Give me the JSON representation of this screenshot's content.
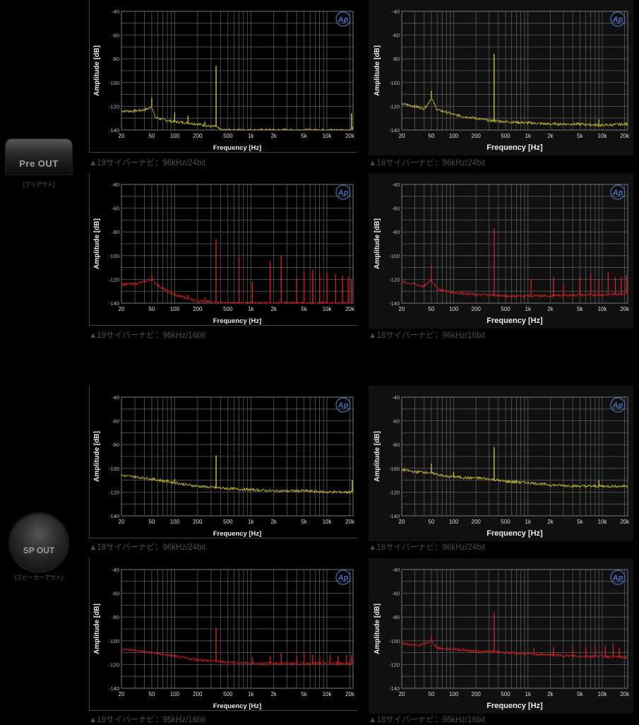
{
  "sections": [
    {
      "label": "Pre OUT",
      "sublabel": "[プリアウト]"
    },
    {
      "label": "SP OUT",
      "sublabel": "[スピーカーアウト]"
    }
  ],
  "colors": {
    "yellow": "#c8c030",
    "red": "#d02020",
    "grid": "#5a5a5a",
    "plot_bg_left": "#000000",
    "plot_bg_right": "#101010",
    "logo": "#4a6fb8"
  },
  "logo_text": "Ap",
  "chart_data": [
    {
      "type": "line",
      "caption": "▲19サイバーナビ：96kHz/24bit",
      "color": "yellow",
      "xlabel": "Frequency [Hz]",
      "ylabel": "Amplitude [dB]",
      "xticks": [
        "20",
        "50",
        "100",
        "200",
        "500",
        "1k",
        "2k",
        "5k",
        "10k",
        "20k"
      ],
      "yticks": [
        "-40",
        "-60",
        "-80",
        "-100",
        "-120",
        "-140"
      ],
      "xlim": [
        20,
        22000
      ],
      "ylim": [
        -140,
        -40
      ],
      "xscale": "log",
      "x": [
        20,
        30,
        40,
        45,
        50,
        55,
        60,
        80,
        100,
        150,
        200,
        250,
        300,
        350,
        400,
        500,
        1000,
        2000,
        5000,
        10000,
        20000,
        22000
      ],
      "y": [
        -124,
        -124,
        -123,
        -122,
        -120,
        -129,
        -130,
        -132,
        -133,
        -134,
        -135,
        -136,
        -137,
        -137,
        -140,
        -140,
        -140,
        -140,
        -140,
        -140,
        -140,
        -138
      ],
      "peaks": [
        [
          50,
          -113
        ],
        [
          100,
          -125
        ],
        [
          150,
          -128
        ],
        [
          250,
          -133
        ],
        [
          350,
          -86
        ],
        [
          21000,
          -126
        ]
      ]
    },
    {
      "type": "line",
      "caption": "▲18サイバーナビ：96kHz/24bit",
      "color": "yellow",
      "xlabel": "Frequency [Hz]",
      "ylabel": "Amplitude [dB]",
      "xticks": [
        "20",
        "50",
        "100",
        "200",
        "500",
        "1k",
        "2k",
        "5k",
        "10k",
        "20k"
      ],
      "yticks": [
        "-40",
        "-60",
        "-80",
        "-100",
        "-120",
        "-140"
      ],
      "xlim": [
        20,
        22000
      ],
      "ylim": [
        -140,
        -40
      ],
      "xscale": "log",
      "x": [
        20,
        30,
        40,
        45,
        50,
        60,
        80,
        100,
        150,
        200,
        300,
        500,
        1000,
        2000,
        5000,
        10000,
        20000,
        22000
      ],
      "y": [
        -118,
        -120,
        -122,
        -118,
        -113,
        -123,
        -125,
        -127,
        -129,
        -130,
        -132,
        -133,
        -134,
        -135,
        -135,
        -136,
        -135,
        -135
      ],
      "peaks": [
        [
          50,
          -107
        ],
        [
          120,
          -127
        ],
        [
          350,
          -76
        ],
        [
          3000,
          -134
        ],
        [
          9000,
          -131
        ]
      ]
    },
    {
      "type": "line",
      "caption": "▲19サイバーナビ：96kHz/16bit",
      "color": "red",
      "xlabel": "Frequency [Hz]",
      "ylabel": "Amplitude [dB]",
      "xticks": [
        "20",
        "50",
        "100",
        "200",
        "500",
        "1k",
        "2k",
        "5k",
        "10k",
        "20k"
      ],
      "yticks": [
        "-40",
        "-60",
        "-80",
        "-100",
        "-120",
        "-140"
      ],
      "xlim": [
        20,
        22000
      ],
      "ylim": [
        -140,
        -40
      ],
      "xscale": "log",
      "x": [
        20,
        30,
        40,
        50,
        60,
        80,
        100,
        150,
        200,
        300,
        500,
        1000,
        2000,
        5000,
        10000,
        20000,
        22000
      ],
      "y": [
        -124,
        -124,
        -122,
        -120,
        -125,
        -130,
        -133,
        -136,
        -138,
        -139,
        -140,
        -140,
        -140,
        -140,
        -140,
        -140,
        -140
      ],
      "peaks": [
        [
          50,
          -116
        ],
        [
          100,
          -130
        ],
        [
          150,
          -133
        ],
        [
          250,
          -135
        ],
        [
          350,
          -86
        ],
        [
          700,
          -102
        ],
        [
          1050,
          -122
        ],
        [
          1800,
          -105
        ],
        [
          2500,
          -100
        ],
        [
          4000,
          -118
        ],
        [
          5000,
          -114
        ],
        [
          6500,
          -112
        ],
        [
          8000,
          -116
        ],
        [
          10000,
          -114
        ],
        [
          13000,
          -116
        ],
        [
          16000,
          -117
        ],
        [
          19000,
          -118
        ],
        [
          21000,
          -120
        ]
      ]
    },
    {
      "type": "line",
      "caption": "▲18サイバーナビ：96kHz/16bit",
      "color": "red",
      "xlabel": "Frequency [Hz]",
      "ylabel": "Amplitude [dB]",
      "xticks": [
        "20",
        "50",
        "100",
        "200",
        "500",
        "1k",
        "2k",
        "5k",
        "10k",
        "20k"
      ],
      "yticks": [
        "-40",
        "-60",
        "-80",
        "-100",
        "-120",
        "-140"
      ],
      "xlim": [
        20,
        22000
      ],
      "ylim": [
        -140,
        -40
      ],
      "xscale": "log",
      "x": [
        20,
        30,
        40,
        50,
        60,
        80,
        100,
        150,
        200,
        300,
        500,
        1000,
        2000,
        5000,
        10000,
        20000,
        22000
      ],
      "y": [
        -122,
        -124,
        -126,
        -120,
        -128,
        -130,
        -131,
        -132,
        -133,
        -133,
        -134,
        -134,
        -134,
        -133,
        -133,
        -132,
        -130
      ],
      "peaks": [
        [
          50,
          -107
        ],
        [
          350,
          -77
        ],
        [
          1100,
          -120
        ],
        [
          2200,
          -118
        ],
        [
          3000,
          -125
        ],
        [
          5000,
          -118
        ],
        [
          7000,
          -116
        ],
        [
          9000,
          -120
        ],
        [
          12000,
          -114
        ],
        [
          15000,
          -118
        ],
        [
          18000,
          -118
        ],
        [
          21000,
          -116
        ]
      ]
    },
    {
      "type": "line",
      "caption": "▲19サイバーナビ：96kHz/24bit",
      "color": "yellow",
      "xlabel": "Frequency [Hz]",
      "ylabel": "Amplitude [dB]",
      "xticks": [
        "20",
        "50",
        "100",
        "200",
        "500",
        "1k",
        "2k",
        "5k",
        "10k",
        "20k"
      ],
      "yticks": [
        "-40",
        "-60",
        "-80",
        "-100",
        "-120",
        "-140"
      ],
      "xlim": [
        20,
        22000
      ],
      "ylim": [
        -140,
        -40
      ],
      "xscale": "log",
      "x": [
        20,
        30,
        50,
        80,
        100,
        150,
        200,
        300,
        500,
        1000,
        2000,
        5000,
        10000,
        20000,
        22000
      ],
      "y": [
        -106,
        -107,
        -109,
        -111,
        -112,
        -114,
        -115,
        -116,
        -117,
        -118,
        -119,
        -119,
        -120,
        -120,
        -120
      ],
      "peaks": [
        [
          100,
          -109
        ],
        [
          350,
          -89
        ],
        [
          21500,
          -110
        ]
      ]
    },
    {
      "type": "line",
      "caption": "▲18サイバーナビ：96kHz/24bit",
      "color": "yellow",
      "xlabel": "Frequency [Hz]",
      "ylabel": "Amplitude [dB]",
      "xticks": [
        "20",
        "50",
        "100",
        "200",
        "500",
        "1k",
        "2k",
        "5k",
        "10k",
        "20k"
      ],
      "yticks": [
        "-40",
        "-60",
        "-80",
        "-100",
        "-120",
        "-140"
      ],
      "xlim": [
        20,
        22000
      ],
      "ylim": [
        -140,
        -40
      ],
      "xscale": "log",
      "x": [
        20,
        30,
        40,
        50,
        60,
        80,
        100,
        150,
        200,
        300,
        500,
        1000,
        2000,
        5000,
        10000,
        20000,
        22000
      ],
      "y": [
        -101,
        -103,
        -103,
        -104,
        -105,
        -107,
        -107,
        -108,
        -108,
        -109,
        -111,
        -112,
        -114,
        -115,
        -115,
        -115,
        -115
      ],
      "peaks": [
        [
          50,
          -96
        ],
        [
          100,
          -103
        ],
        [
          350,
          -82
        ],
        [
          500,
          -110
        ],
        [
          9000,
          -110
        ]
      ]
    },
    {
      "type": "line",
      "caption": "▲19サイバーナビ：96kHz/16bit",
      "color": "red",
      "xlabel": "Frequency [Hz]",
      "ylabel": "Amplitude [dB]",
      "xticks": [
        "20",
        "50",
        "100",
        "200",
        "500",
        "1k",
        "2k",
        "5k",
        "10k",
        "20k"
      ],
      "yticks": [
        "-40",
        "-60",
        "-80",
        "-100",
        "-120",
        "-140"
      ],
      "xlim": [
        20,
        22000
      ],
      "ylim": [
        -140,
        -40
      ],
      "xscale": "log",
      "x": [
        20,
        30,
        50,
        80,
        100,
        150,
        200,
        300,
        500,
        1000,
        2000,
        5000,
        10000,
        20000,
        22000
      ],
      "y": [
        -107,
        -108,
        -110,
        -112,
        -113,
        -115,
        -116,
        -117,
        -118,
        -119,
        -119,
        -119,
        -119,
        -119,
        -119
      ],
      "peaks": [
        [
          100,
          -112
        ],
        [
          350,
          -89
        ],
        [
          1050,
          -114
        ],
        [
          1800,
          -113
        ],
        [
          2500,
          -110
        ],
        [
          4000,
          -113
        ],
        [
          5000,
          -111
        ],
        [
          6500,
          -112
        ],
        [
          8000,
          -113
        ],
        [
          11000,
          -112
        ],
        [
          14000,
          -113
        ],
        [
          18000,
          -112
        ],
        [
          21000,
          -112
        ]
      ]
    },
    {
      "type": "line",
      "caption": "▲18サイバーナビ：96kHz/16bit",
      "color": "red",
      "xlabel": "Frequency [Hz]",
      "ylabel": "Amplitude [dB]",
      "xticks": [
        "20",
        "50",
        "100",
        "200",
        "500",
        "1k",
        "2k",
        "5k",
        "10k",
        "20k"
      ],
      "yticks": [
        "-40",
        "-60",
        "-80",
        "-100",
        "-120",
        "-140"
      ],
      "xlim": [
        20,
        22000
      ],
      "ylim": [
        -140,
        -40
      ],
      "xscale": "log",
      "x": [
        20,
        30,
        40,
        50,
        60,
        80,
        100,
        150,
        200,
        300,
        500,
        1000,
        2000,
        5000,
        10000,
        20000,
        22000
      ],
      "y": [
        -102,
        -104,
        -103,
        -100,
        -106,
        -107,
        -107,
        -108,
        -109,
        -109,
        -110,
        -111,
        -112,
        -113,
        -113,
        -114,
        -114
      ],
      "peaks": [
        [
          50,
          -95
        ],
        [
          350,
          -76
        ],
        [
          1200,
          -106
        ],
        [
          2200,
          -105
        ],
        [
          4000,
          -105
        ],
        [
          6000,
          -104
        ],
        [
          8000,
          -104
        ],
        [
          11000,
          -105
        ],
        [
          14000,
          -102
        ],
        [
          17000,
          -106
        ]
      ]
    }
  ]
}
